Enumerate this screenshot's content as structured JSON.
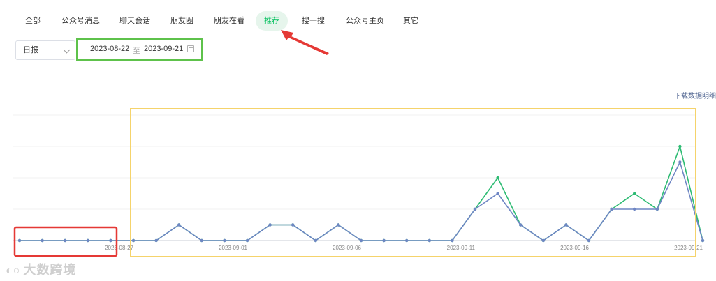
{
  "tabs": [
    {
      "label": "全部"
    },
    {
      "label": "公众号消息"
    },
    {
      "label": "聊天会话"
    },
    {
      "label": "朋友圈"
    },
    {
      "label": "朋友在看"
    },
    {
      "label": "推荐",
      "active": true
    },
    {
      "label": "搜一搜"
    },
    {
      "label": "公众号主页"
    },
    {
      "label": "其它"
    }
  ],
  "filters": {
    "period": "日报",
    "start_date": "2023-08-22",
    "separator": "至",
    "end_date": "2023-09-21"
  },
  "download_link": "下载数据明细",
  "watermark": "大数跨境",
  "colors": {
    "accent": "#07c160",
    "series_blue": "#6f86c4",
    "series_green": "#2dbb73",
    "highlight_red": "#e53935",
    "highlight_yellow": "#f5d36b",
    "highlight_green": "#5ec24b",
    "arrow_red": "#e53935"
  },
  "chart_data": {
    "type": "line",
    "x": [
      "2023-08-22",
      "2023-08-23",
      "2023-08-24",
      "2023-08-25",
      "2023-08-26",
      "2023-08-27",
      "2023-08-28",
      "2023-08-29",
      "2023-08-30",
      "2023-08-31",
      "2023-09-01",
      "2023-09-02",
      "2023-09-03",
      "2023-09-04",
      "2023-09-05",
      "2023-09-06",
      "2023-09-07",
      "2023-09-08",
      "2023-09-09",
      "2023-09-10",
      "2023-09-11",
      "2023-09-12",
      "2023-09-13",
      "2023-09-14",
      "2023-09-15",
      "2023-09-16",
      "2023-09-17",
      "2023-09-18",
      "2023-09-19",
      "2023-09-20",
      "2023-09-21"
    ],
    "x_tick_labels": [
      "2023-08-27",
      "2023-09-01",
      "2023-09-06",
      "2023-09-11",
      "2023-09-16",
      "2023-09-21"
    ],
    "series": [
      {
        "color": "#6f86c4",
        "values": [
          0,
          0,
          0,
          0,
          0,
          0,
          0,
          1,
          0,
          0,
          0,
          1,
          1,
          0,
          1,
          0,
          0,
          0,
          0,
          0,
          2,
          3,
          1,
          0,
          1,
          0,
          2,
          2,
          2,
          5,
          0
        ]
      },
      {
        "color": "#2dbb73",
        "values": [
          0,
          0,
          0,
          0,
          0,
          0,
          0,
          1,
          0,
          0,
          0,
          1,
          1,
          0,
          1,
          0,
          0,
          0,
          0,
          0,
          2,
          4,
          1,
          0,
          1,
          0,
          2,
          3,
          2,
          6,
          0
        ]
      }
    ],
    "ylim": [
      0,
      8
    ],
    "grid": true,
    "legend": "none"
  }
}
